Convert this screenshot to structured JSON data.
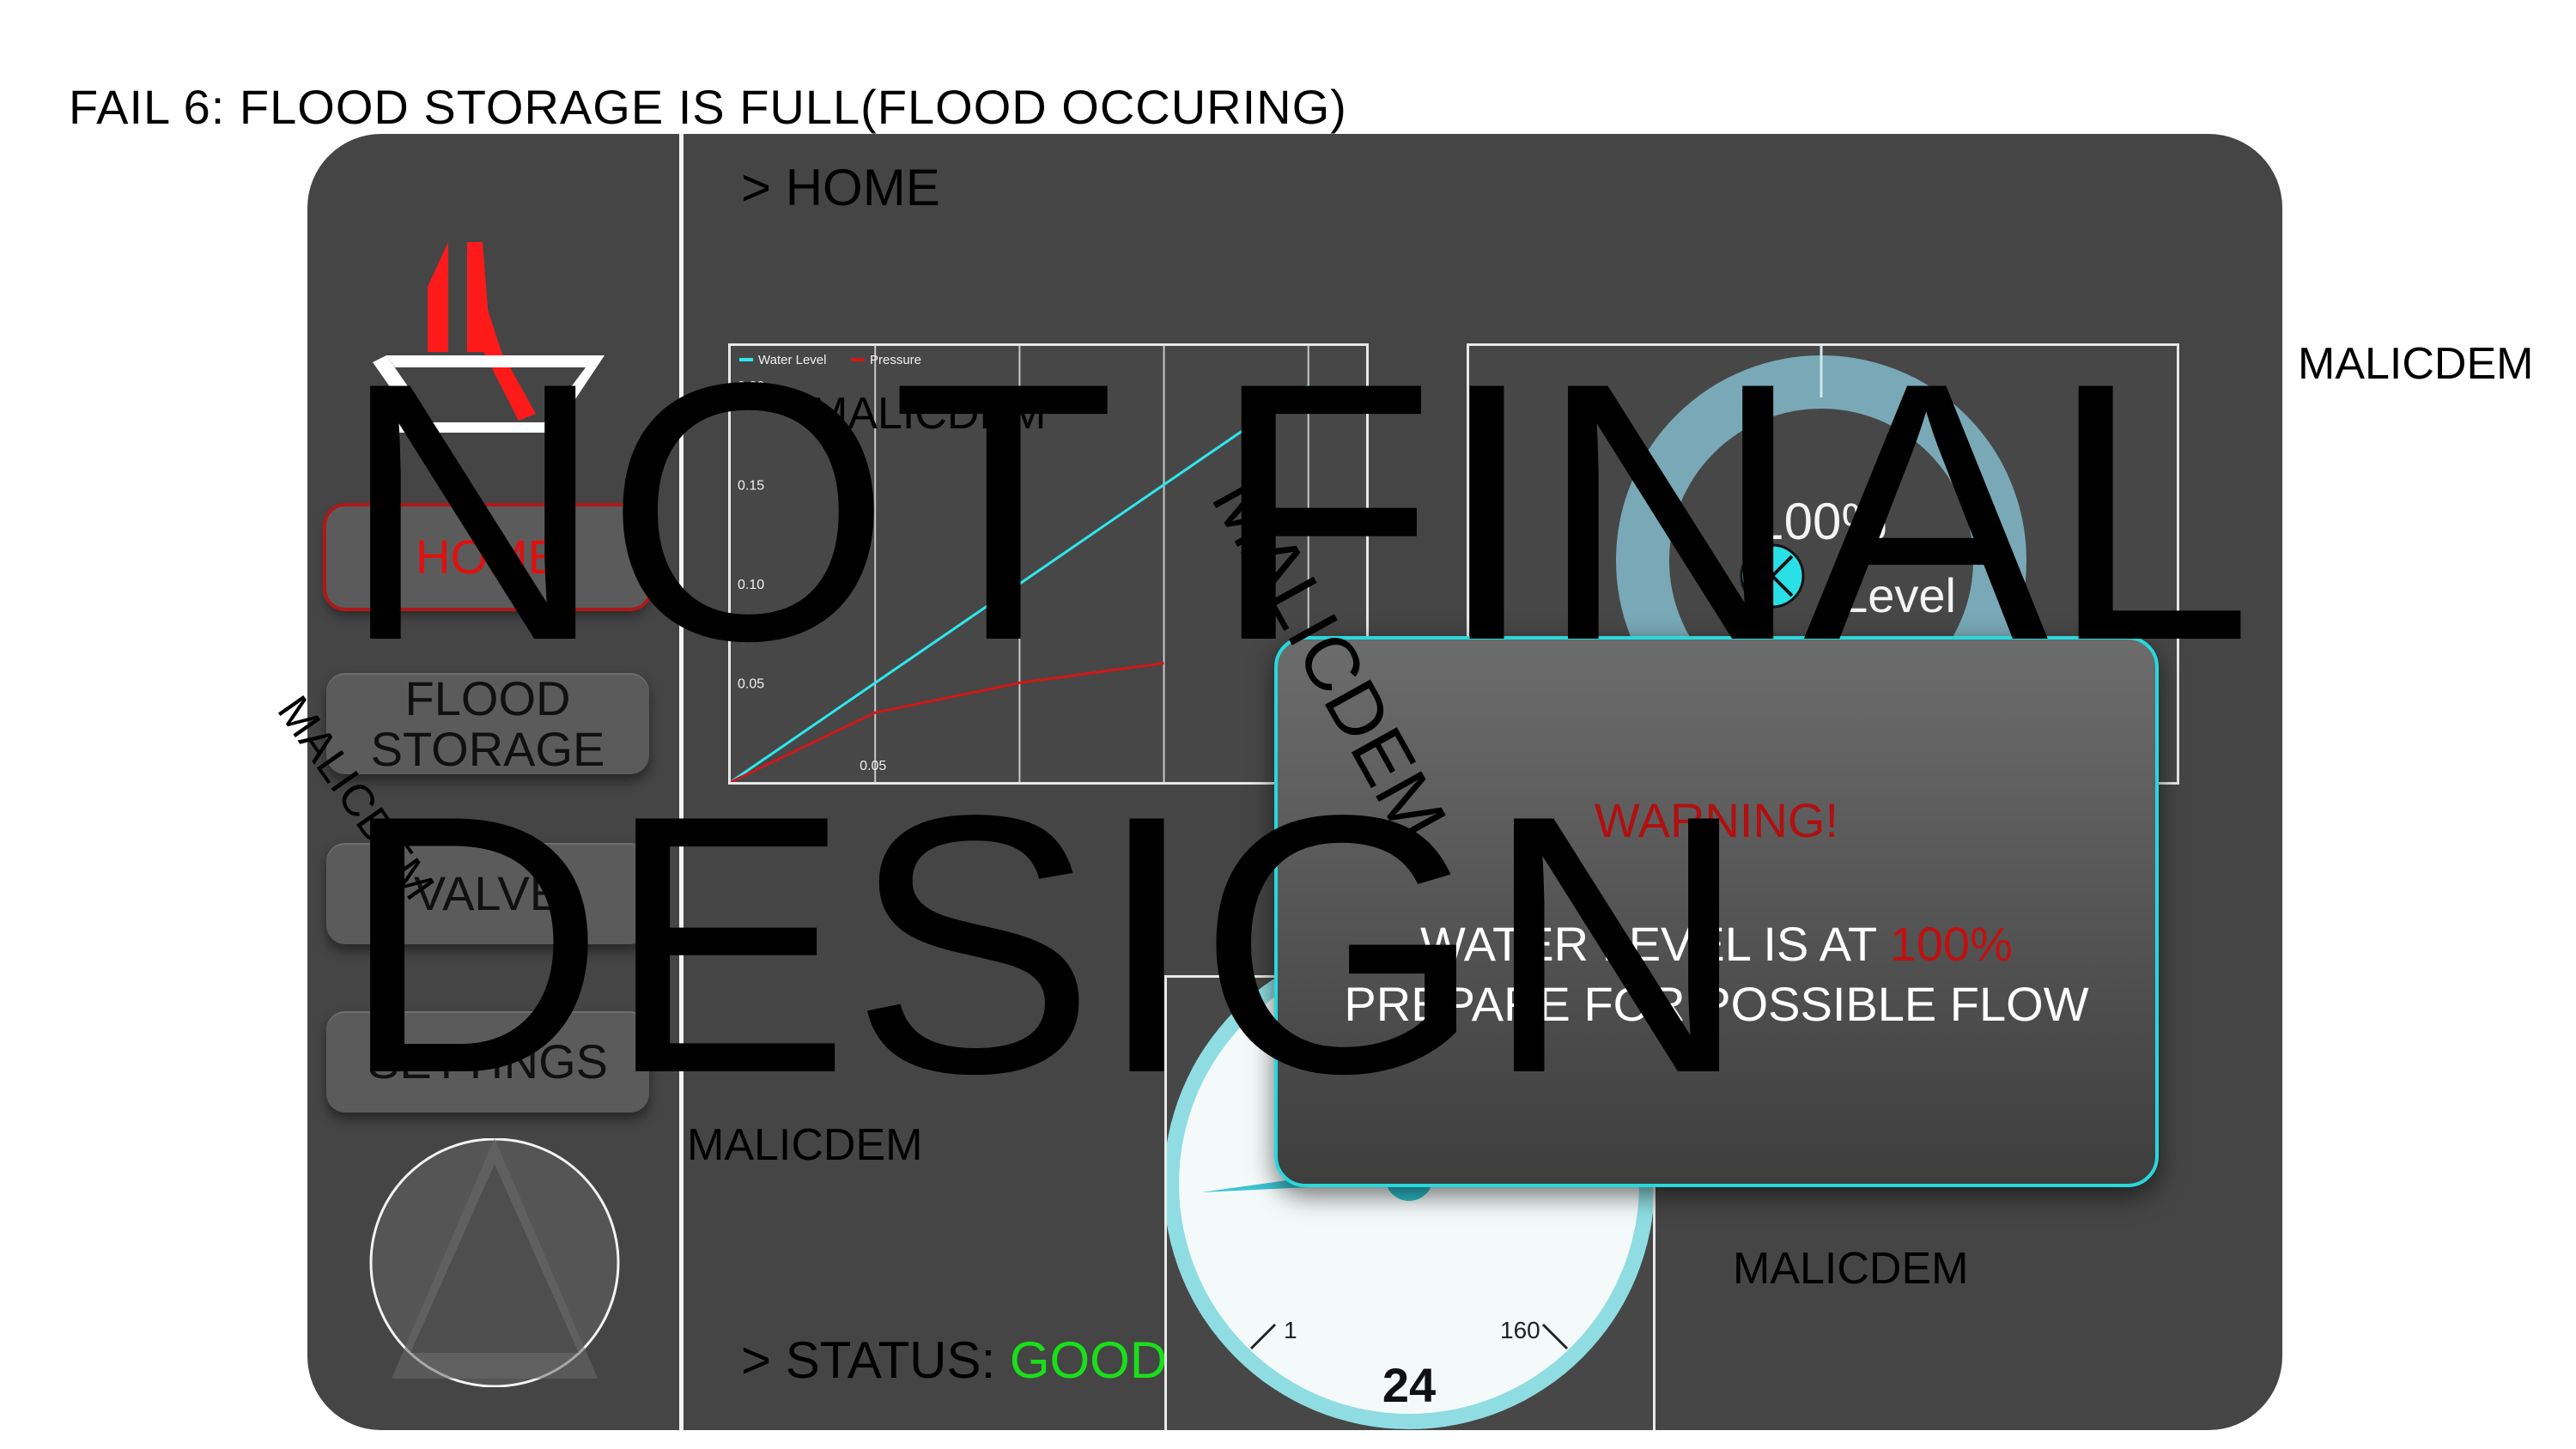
{
  "caption": "FAIL 6: FLOOD STORAGE IS FULL(FLOOD OCCURING)",
  "breadcrumb": "> HOME",
  "status": {
    "prefix": "> STATUS: ",
    "value": "GOOD"
  },
  "nav": [
    {
      "label": "HOME",
      "active": true
    },
    {
      "label": "FLOOD\nSTORAGE",
      "active": false
    },
    {
      "label": "VALVE",
      "active": false
    },
    {
      "label": "SETTINGS",
      "active": false
    }
  ],
  "chart_data": {
    "type": "line",
    "series": [
      {
        "name": "Water Level",
        "color": "#2ee8ee",
        "x": [
          0,
          0.05,
          0.1,
          0.15,
          0.2
        ],
        "y": [
          0,
          0.05,
          0.1,
          0.15,
          0.2
        ]
      },
      {
        "name": "Pressure",
        "color": "#d01818",
        "x": [
          0,
          0.05,
          0.1,
          0.15
        ],
        "y": [
          0,
          0.035,
          0.05,
          0.06
        ]
      }
    ],
    "y_ticks": [
      "0.20",
      "0.15",
      "0.10",
      "0.05"
    ],
    "x_ticks": [
      "0.05"
    ],
    "grid": true,
    "legend": "top-left"
  },
  "level_gauge": {
    "percent_text": "100%",
    "label": "Level",
    "value": 100
  },
  "pressure_meter": {
    "value": "24",
    "min_label": "1",
    "max_label": "160"
  },
  "popup": {
    "title": "WARNING!",
    "line1_prefix": "WATER LEVEL IS AT ",
    "line1_value": "100%",
    "line2": "PREPARE FOR POSSIBLE FLOW"
  },
  "watermarks": [
    "MALICDEM",
    "MALICDEM",
    "MALICDEM",
    "MALICDEM",
    "MALICDEM",
    "MALICDEM"
  ],
  "overlay": {
    "line1": "NOT FINAL",
    "line2": "DESIGN"
  },
  "colors": {
    "device": "#454545",
    "accent": "#28d8dc",
    "alert": "#e01010",
    "good": "#19e019"
  }
}
